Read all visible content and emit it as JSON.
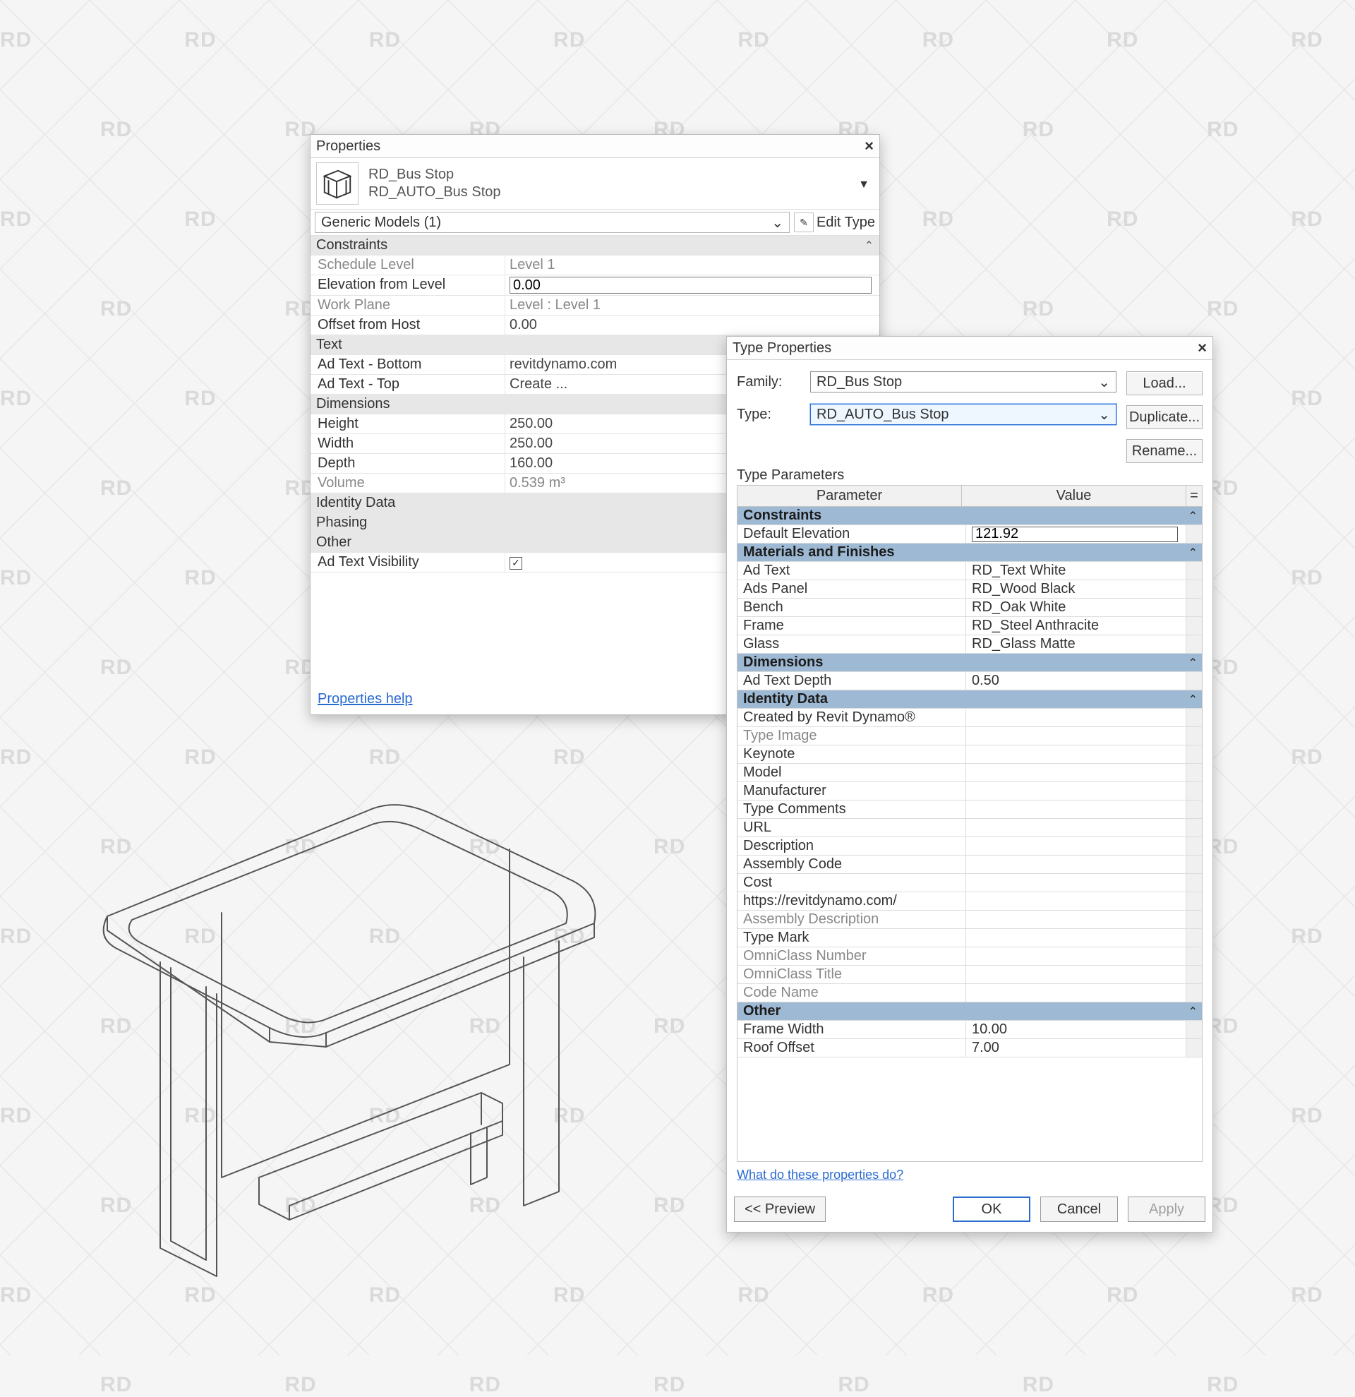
{
  "watermark": "RD",
  "wireframe_label": "bus-stop-wireframe",
  "properties": {
    "panel_title": "Properties",
    "close_label": "×",
    "family_name": "RD_Bus Stop",
    "family_type": "RD_AUTO_Bus Stop",
    "filter_text": "Generic Models (1)",
    "edit_type_label": "Edit Type",
    "groups": {
      "constraints": "Constraints",
      "text": "Text",
      "dimensions": "Dimensions",
      "identity": "Identity Data",
      "phasing": "Phasing",
      "other": "Other"
    },
    "rows": {
      "schedule_level": {
        "k": "Schedule Level",
        "v": "Level 1"
      },
      "elev_from_level": {
        "k": "Elevation from Level",
        "v": "0.00"
      },
      "work_plane": {
        "k": "Work Plane",
        "v": "Level : Level 1"
      },
      "offset_from_host": {
        "k": "Offset from Host",
        "v": "0.00"
      },
      "ad_text_bottom": {
        "k": "Ad Text - Bottom",
        "v": "revitdynamo.com"
      },
      "ad_text_top": {
        "k": "Ad Text - Top",
        "v": "Create ..."
      },
      "height": {
        "k": "Height",
        "v": "250.00"
      },
      "width": {
        "k": "Width",
        "v": "250.00"
      },
      "depth": {
        "k": "Depth",
        "v": "160.00"
      },
      "volume": {
        "k": "Volume",
        "v": "0.539 m³"
      },
      "ad_text_vis": {
        "k": "Ad Text Visibility",
        "checked": true
      }
    },
    "help_link": "Properties help"
  },
  "type_props": {
    "panel_title": "Type Properties",
    "close_label": "×",
    "family_label": "Family:",
    "family_value": "RD_Bus Stop",
    "type_label": "Type:",
    "type_value": "RD_AUTO_Bus Stop",
    "buttons": {
      "load": "Load...",
      "duplicate": "Duplicate...",
      "rename": "Rename..."
    },
    "subtitle": "Type Parameters",
    "head_param": "Parameter",
    "head_value": "Value",
    "head_eq": "=",
    "cats": {
      "constraints": "Constraints",
      "materials": "Materials and Finishes",
      "dimensions": "Dimensions",
      "identity": "Identity Data",
      "other": "Other"
    },
    "rows": {
      "default_elev": {
        "k": "Default Elevation",
        "v": "121.92"
      },
      "ad_text": {
        "k": "Ad Text",
        "v": "RD_Text White"
      },
      "ads_panel": {
        "k": "Ads Panel",
        "v": "RD_Wood Black"
      },
      "bench": {
        "k": "Bench",
        "v": "RD_Oak White"
      },
      "frame": {
        "k": "Frame",
        "v": "RD_Steel Anthracite"
      },
      "glass": {
        "k": "Glass",
        "v": "RD_Glass Matte"
      },
      "ad_text_depth": {
        "k": "Ad Text Depth",
        "v": "0.50"
      },
      "created_by": {
        "k": "Created by Revit Dynamo®",
        "v": ""
      },
      "type_image": {
        "k": "Type Image",
        "v": ""
      },
      "keynote": {
        "k": "Keynote",
        "v": ""
      },
      "model": {
        "k": "Model",
        "v": ""
      },
      "manufacturer": {
        "k": "Manufacturer",
        "v": ""
      },
      "type_comments": {
        "k": "Type Comments",
        "v": ""
      },
      "url": {
        "k": "URL",
        "v": ""
      },
      "description": {
        "k": "Description",
        "v": ""
      },
      "assembly_code": {
        "k": "Assembly Code",
        "v": ""
      },
      "cost": {
        "k": "Cost",
        "v": ""
      },
      "link": {
        "k": "https://revitdynamo.com/",
        "v": ""
      },
      "assembly_desc": {
        "k": "Assembly Description",
        "v": ""
      },
      "type_mark": {
        "k": "Type Mark",
        "v": ""
      },
      "omni_num": {
        "k": "OmniClass Number",
        "v": ""
      },
      "omni_title": {
        "k": "OmniClass Title",
        "v": ""
      },
      "code_name": {
        "k": "Code Name",
        "v": ""
      },
      "frame_width": {
        "k": "Frame Width",
        "v": "10.00"
      },
      "roof_offset": {
        "k": "Roof Offset",
        "v": "7.00"
      }
    },
    "footer_link": "What do these properties do?",
    "footer_buttons": {
      "preview": "<<  Preview",
      "ok": "OK",
      "cancel": "Cancel",
      "apply": "Apply"
    }
  }
}
